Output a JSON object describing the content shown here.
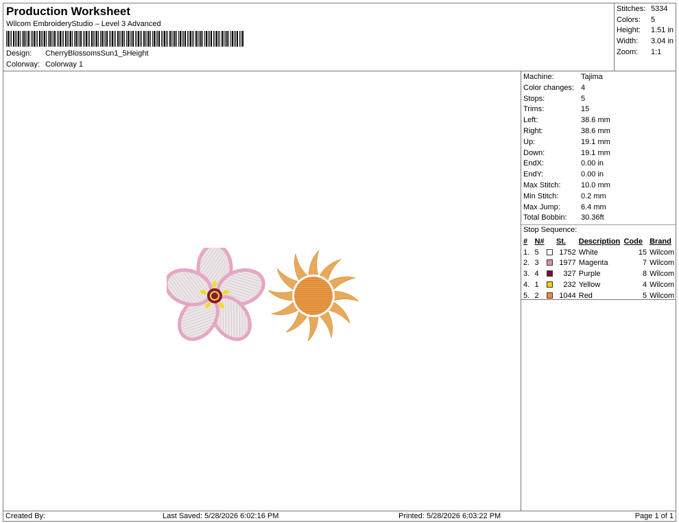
{
  "header": {
    "title": "Production Worksheet",
    "subtitle": "Wilcom EmbroideryStudio – Level 3 Advanced",
    "design_label": "Design:",
    "design_value": "CherryBlossomsSun1_5Height",
    "colorway_label": "Colorway:",
    "colorway_value": "Colorway 1"
  },
  "summary": [
    {
      "label": "Stitches:",
      "value": "5334"
    },
    {
      "label": "Colors:",
      "value": "5"
    },
    {
      "label": "Height:",
      "value": "1.51 in"
    },
    {
      "label": "Width:",
      "value": "3.04 in"
    },
    {
      "label": "Zoom:",
      "value": "1:1"
    }
  ],
  "machine_info": [
    {
      "label": "Machine:",
      "value": "Tajima"
    },
    {
      "label": "Color changes:",
      "value": "4"
    },
    {
      "label": "Stops:",
      "value": "5"
    },
    {
      "label": "Trims:",
      "value": "15"
    },
    {
      "label": "Left:",
      "value": "38.6 mm"
    },
    {
      "label": "Right:",
      "value": "38.6 mm"
    },
    {
      "label": "Up:",
      "value": "19.1 mm"
    },
    {
      "label": "Down:",
      "value": "19.1 mm"
    },
    {
      "label": "EndX:",
      "value": "0.00 in"
    },
    {
      "label": "EndY:",
      "value": "0.00 in"
    },
    {
      "label": "Max Stitch:",
      "value": "10.0 mm"
    },
    {
      "label": "Min Stitch:",
      "value": "0.2 mm"
    },
    {
      "label": "Max Jump:",
      "value": "6.4 mm"
    },
    {
      "label": "Total Bobbin:",
      "value": "30.36ft"
    }
  ],
  "stop_sequence": {
    "title": "Stop Sequence:",
    "headers": {
      "num": "#",
      "n": "N#",
      "st": "St.",
      "desc": "Description",
      "code": "Code",
      "brand": "Brand"
    },
    "rows": [
      {
        "num": "1.",
        "n": "5",
        "color": "#ffffff",
        "st": "1752",
        "desc": "White",
        "code": "15",
        "brand": "Wilcom"
      },
      {
        "num": "2.",
        "n": "3",
        "color": "#e58aa8",
        "st": "1977",
        "desc": "Magenta",
        "code": "7",
        "brand": "Wilcom"
      },
      {
        "num": "3.",
        "n": "4",
        "color": "#7a1030",
        "st": "327",
        "desc": "Purple",
        "code": "8",
        "brand": "Wilcom"
      },
      {
        "num": "4.",
        "n": "1",
        "color": "#f5d000",
        "st": "232",
        "desc": "Yellow",
        "code": "4",
        "brand": "Wilcom"
      },
      {
        "num": "5.",
        "n": "2",
        "color": "#f08a3a",
        "st": "1044",
        "desc": "Red",
        "code": "5",
        "brand": "Wilcom"
      }
    ]
  },
  "footer": {
    "created_by": "Created By:",
    "last_saved": "Last Saved: 5/28/2026 6:02:16 PM",
    "printed": "Printed: 5/28/2026 6:03:22 PM",
    "page": "Page 1 of 1"
  },
  "design_colors": {
    "petal_outline": "#e6a6c4",
    "petal_fill": "#eae3e6",
    "center": "#8a1a2a",
    "stamen": "#f2dc2a",
    "sun_rays": "#e7a95a",
    "sun_disc": "#e89a48"
  }
}
